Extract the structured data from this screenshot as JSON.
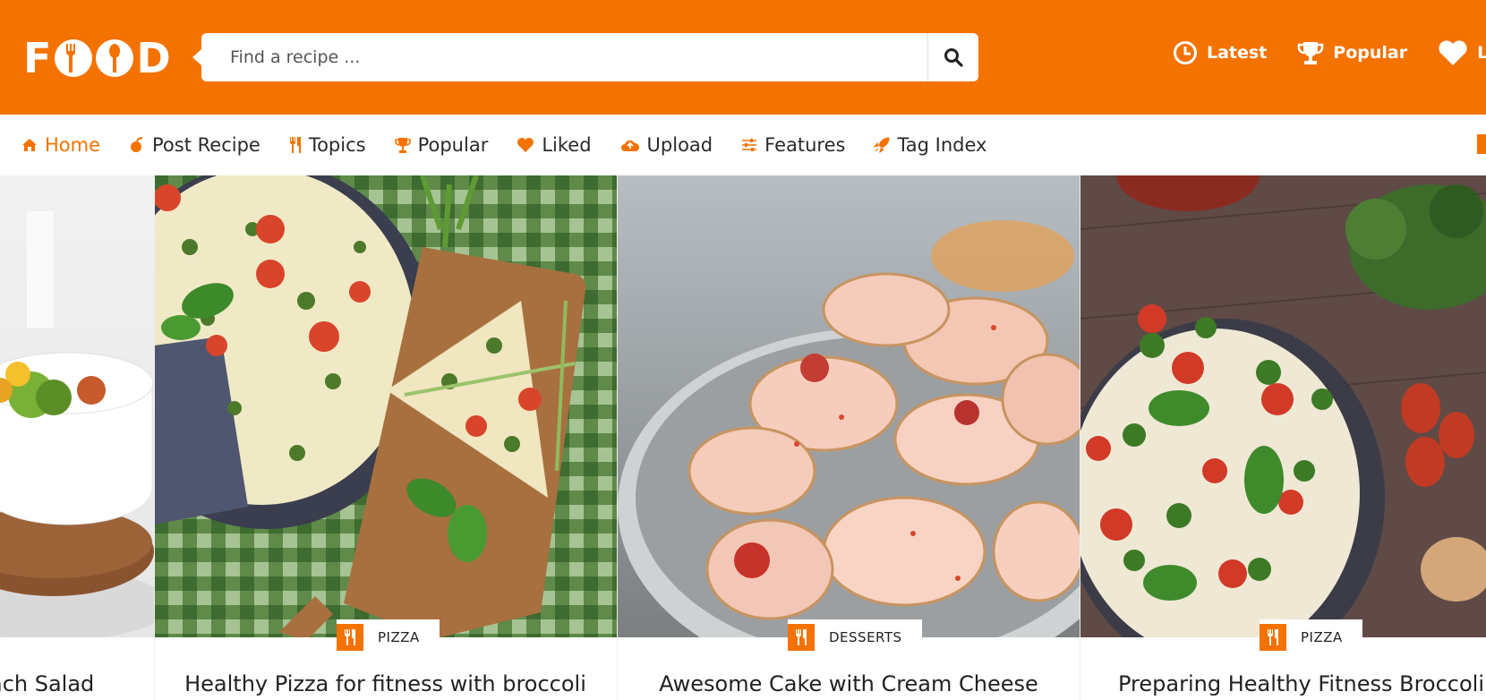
{
  "header": {
    "logo_text": "FOOD",
    "search_placeholder": "Find a recipe ...",
    "links": [
      {
        "label": "Latest",
        "icon": "clock-icon"
      },
      {
        "label": "Popular",
        "icon": "trophy-icon"
      },
      {
        "label": "L",
        "icon": "heart-icon"
      }
    ]
  },
  "nav": {
    "items": [
      {
        "label": "Home",
        "icon": "home-icon",
        "active": true
      },
      {
        "label": "Post Recipe",
        "icon": "apple-icon"
      },
      {
        "label": "Topics",
        "icon": "utensils-icon"
      },
      {
        "label": "Popular",
        "icon": "trophy-icon"
      },
      {
        "label": "Liked",
        "icon": "heart-icon"
      },
      {
        "label": "Upload",
        "icon": "cloud-upload-icon"
      },
      {
        "label": "Features",
        "icon": "sliders-icon"
      },
      {
        "label": "Tag Index",
        "icon": "rocket-icon"
      }
    ]
  },
  "cards": [
    {
      "title": "ach Salad",
      "category": ""
    },
    {
      "title": "Healthy Pizza for fitness with broccoli",
      "category": "PIZZA"
    },
    {
      "title": "Awesome Cake with Cream Cheese",
      "category": "DESSERTS"
    },
    {
      "title": "Preparing Healthy Fitness Broccoli P",
      "category": "PIZZA"
    }
  ],
  "colors": {
    "accent": "#f47200",
    "text": "#222222"
  }
}
